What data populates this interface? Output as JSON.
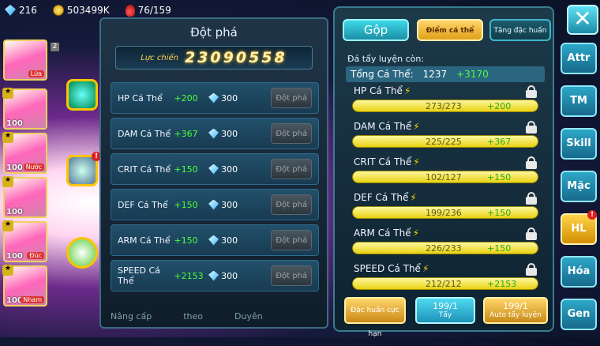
{
  "resources": {
    "gems": "216",
    "gold": "503499K",
    "stamina": "76/159"
  },
  "characters": [
    {
      "level": "",
      "tag": "Lửa",
      "tag2": "Bay",
      "num": "2"
    },
    {
      "level": "100",
      "tag": "Lửa",
      "tag2": "Thép",
      "num": ""
    },
    {
      "level": "100",
      "tag": "Nước",
      "tag2": "Yêu",
      "num": ""
    },
    {
      "level": "100",
      "tag": "Lửa",
      "tag2": "",
      "num": ""
    },
    {
      "level": "100",
      "tag": "Đúc",
      "tag2": "",
      "num": ""
    },
    {
      "level": "100",
      "tag": "Nham",
      "tag2": "Yêu",
      "num": ""
    }
  ],
  "breakthrough": {
    "title": "Đột phá",
    "power_label": "Lực chiến",
    "power_value": "23090558",
    "button_label": "Đột phá",
    "rows": [
      {
        "name": "HP Cá Thể",
        "bonus": "+200",
        "cost": "300"
      },
      {
        "name": "DAM Cá Thể",
        "bonus": "+367",
        "cost": "300"
      },
      {
        "name": "CRIT Cá Thể",
        "bonus": "+150",
        "cost": "300"
      },
      {
        "name": "DEF Cá Thể",
        "bonus": "+150",
        "cost": "300"
      },
      {
        "name": "ARM Cá Thể",
        "bonus": "+150",
        "cost": "300"
      },
      {
        "name": "SPEED Cá Thể",
        "bonus": "+2153",
        "cost": "300"
      }
    ],
    "bottom_tabs": [
      "Nâng cấp",
      "theo",
      "Duyên"
    ]
  },
  "panel": {
    "tabs": {
      "gop": "Gộp",
      "diem": "Điểm cá thể",
      "tang": "Tăng đặc huấn"
    },
    "remain_label": "Đá tẩy luyện còn:",
    "total_label": "Tổng Cá Thể:",
    "total_value": "1237",
    "total_bonus": "+3170",
    "stats": [
      {
        "name": "HP Cá Thể",
        "value": "273/273",
        "bonus": "+200"
      },
      {
        "name": "DAM Cá Thể",
        "value": "225/225",
        "bonus": "+367"
      },
      {
        "name": "CRIT Cá Thể",
        "value": "102/127",
        "bonus": "+150"
      },
      {
        "name": "DEF Cá Thể",
        "value": "199/236",
        "bonus": "+150"
      },
      {
        "name": "ARM Cá Thể",
        "value": "226/233",
        "bonus": "+150"
      },
      {
        "name": "SPEED Cá Thể",
        "value": "212/212",
        "bonus": "+2153"
      }
    ],
    "buttons": {
      "dac_huan": "Đặc huấn cực hạn",
      "tay_count": "199/1",
      "tay_label": "Tẩy",
      "auto_count": "199/1",
      "auto_label": "Auto tẩy luyện"
    }
  },
  "nav": {
    "close": "✕",
    "items": [
      "Attr",
      "TM",
      "Skill",
      "Mặc",
      "HL",
      "Hóa",
      "Gen"
    ]
  }
}
